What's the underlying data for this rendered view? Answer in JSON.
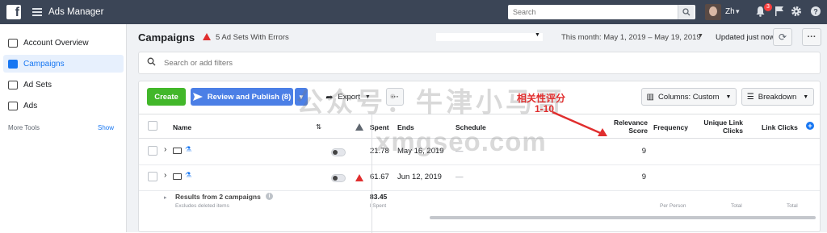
{
  "topbar": {
    "app_title": "Ads Manager",
    "search_placeholder": "Search",
    "user_name": "Zh",
    "notification_count": "3",
    "icons": [
      "facebook-logo-icon",
      "menu-icon",
      "search-icon",
      "bell-icon",
      "flag-icon",
      "gear-icon",
      "help-icon"
    ]
  },
  "sidebar": {
    "items": [
      {
        "label": "Account Overview",
        "icon": "account-overview-icon",
        "active": false
      },
      {
        "label": "Campaigns",
        "icon": "folder-icon",
        "active": true
      },
      {
        "label": "Ad Sets",
        "icon": "grid-icon",
        "active": false
      },
      {
        "label": "Ads",
        "icon": "square-icon",
        "active": false
      }
    ],
    "more_tools": "More Tools",
    "show": "Show"
  },
  "header": {
    "title": "Campaigns",
    "errors": "5 Ad Sets With Errors",
    "date_range": "This month: May 1, 2019 – May 19, 2019",
    "updated": "Updated just now"
  },
  "filter": {
    "placeholder": "Search or add filters"
  },
  "toolbar": {
    "create": "Create",
    "review_publish": "Review and Publish (8)",
    "export": "Export",
    "more": "···",
    "columns": "Columns: Custom",
    "breakdown": "Breakdown"
  },
  "table": {
    "headers": {
      "name": "Name",
      "spent": "Spent",
      "ends": "Ends",
      "schedule": "Schedule",
      "relevance_1": "Relevance",
      "relevance_2": "Score",
      "frequency": "Frequency",
      "unique_link_1": "Unique Link",
      "unique_link_2": "Clicks",
      "link_clicks": "Link Clicks"
    },
    "rows": [
      {
        "spent": "21.78",
        "ends": "May 16, 2019",
        "schedule": "—",
        "relevance": "9",
        "warning": false
      },
      {
        "spent": "61.67",
        "ends": "Jun 12, 2019",
        "schedule": "—",
        "relevance": "9",
        "warning": true
      }
    ],
    "summary": {
      "label": "Results from 2 campaigns",
      "sub": "Excludes deleted items",
      "spent": "83.45",
      "spent_sub": "l Spent",
      "frequency_sub": "Per Person",
      "unique_sub": "Total",
      "link_sub": "Total"
    }
  },
  "overlay": {
    "watermark_line1": "公众号：牛津小马哥",
    "watermark_line2": "xmgseo.com",
    "annotation_line1": "相关性评分",
    "annotation_line2": "1-10",
    "annotation_color": "#e02e2e"
  },
  "colors": {
    "topbar": "#3b4556",
    "accent": "#1877f2",
    "create_green": "#42b72a",
    "review_blue": "#4b7fe6",
    "error_red": "#e02e2e"
  }
}
